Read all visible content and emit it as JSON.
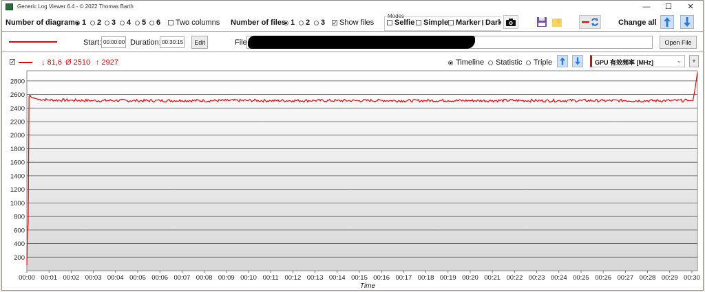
{
  "window": {
    "title": "Generic Log Viewer 6.4 - © 2022 Thomas Barth",
    "minimize": "—",
    "maximize": "☐",
    "close": "✕"
  },
  "toolbar": {
    "diagrams_label": "Number of diagrams",
    "diagram_options": [
      "1",
      "2",
      "3",
      "4",
      "5",
      "6"
    ],
    "diagram_selected": "1",
    "two_columns": "Two columns",
    "files_label": "Number of files",
    "file_options": [
      "1",
      "2",
      "3"
    ],
    "file_selected": "1",
    "show_files": "Show files",
    "modes_caption": "Modes",
    "modes": [
      "Selfie",
      "Simple",
      "Marker",
      "Dark"
    ],
    "change_all": "Change all"
  },
  "file_row": {
    "start_label": "Start:",
    "start_value": "00:00:00",
    "duration_label": "Duration:",
    "duration_value": "00:30:15",
    "edit_button": "Edit",
    "file_label": "File:",
    "open_file_button": "Open File"
  },
  "stats": {
    "min": "↓ 81,6",
    "avg": "Ø 2510",
    "max": "↑ 2927"
  },
  "view_modes": [
    "Timeline",
    "Statistic",
    "Triple"
  ],
  "view_selected": "Timeline",
  "sensor_select": "GPU 有效频率 [MHz]",
  "add_button": "+",
  "colors": {
    "series": "#ee0000",
    "accent_blue": "#cfe0f5"
  },
  "chart_data": {
    "type": "line",
    "xlabel": "Time",
    "ylabel": "",
    "ylim": [
      0,
      2950
    ],
    "yticks": [
      200,
      400,
      600,
      800,
      1000,
      1200,
      1400,
      1600,
      1800,
      2000,
      2200,
      2400,
      2600,
      2800
    ],
    "xticks": [
      "00:00",
      "00:01",
      "00:02",
      "00:03",
      "00:04",
      "00:05",
      "00:06",
      "00:07",
      "00:08",
      "00:09",
      "00:10",
      "00:11",
      "00:12",
      "00:13",
      "00:14",
      "00:15",
      "00:16",
      "00:17",
      "00:18",
      "00:19",
      "00:20",
      "00:21",
      "00:22",
      "00:23",
      "00:24",
      "00:25",
      "00:26",
      "00:27",
      "00:28",
      "00:29",
      "00:30"
    ],
    "grid": true,
    "series": [
      {
        "name": "GPU 有效频率 [MHz]",
        "x_minutes": [
          0,
          0.03,
          0.06,
          0.1,
          0.14,
          0.2,
          0.3,
          0.5,
          1,
          2,
          3,
          4,
          5,
          6,
          7,
          8,
          9,
          10,
          11,
          12,
          13,
          14,
          15,
          16,
          17,
          18,
          19,
          20,
          21,
          22,
          23,
          24,
          25,
          26,
          27,
          28,
          29,
          29.8,
          30.05,
          30.15,
          30.25
        ],
        "values": [
          81.6,
          600,
          700,
          2570,
          2590,
          2560,
          2550,
          2530,
          2520,
          2515,
          2510,
          2512,
          2508,
          2510,
          2511,
          2509,
          2510,
          2512,
          2508,
          2510,
          2511,
          2509,
          2510,
          2512,
          2508,
          2510,
          2511,
          2509,
          2510,
          2512,
          2508,
          2510,
          2511,
          2509,
          2510,
          2508,
          2510,
          2510,
          2512,
          2700,
          2927
        ]
      }
    ]
  }
}
